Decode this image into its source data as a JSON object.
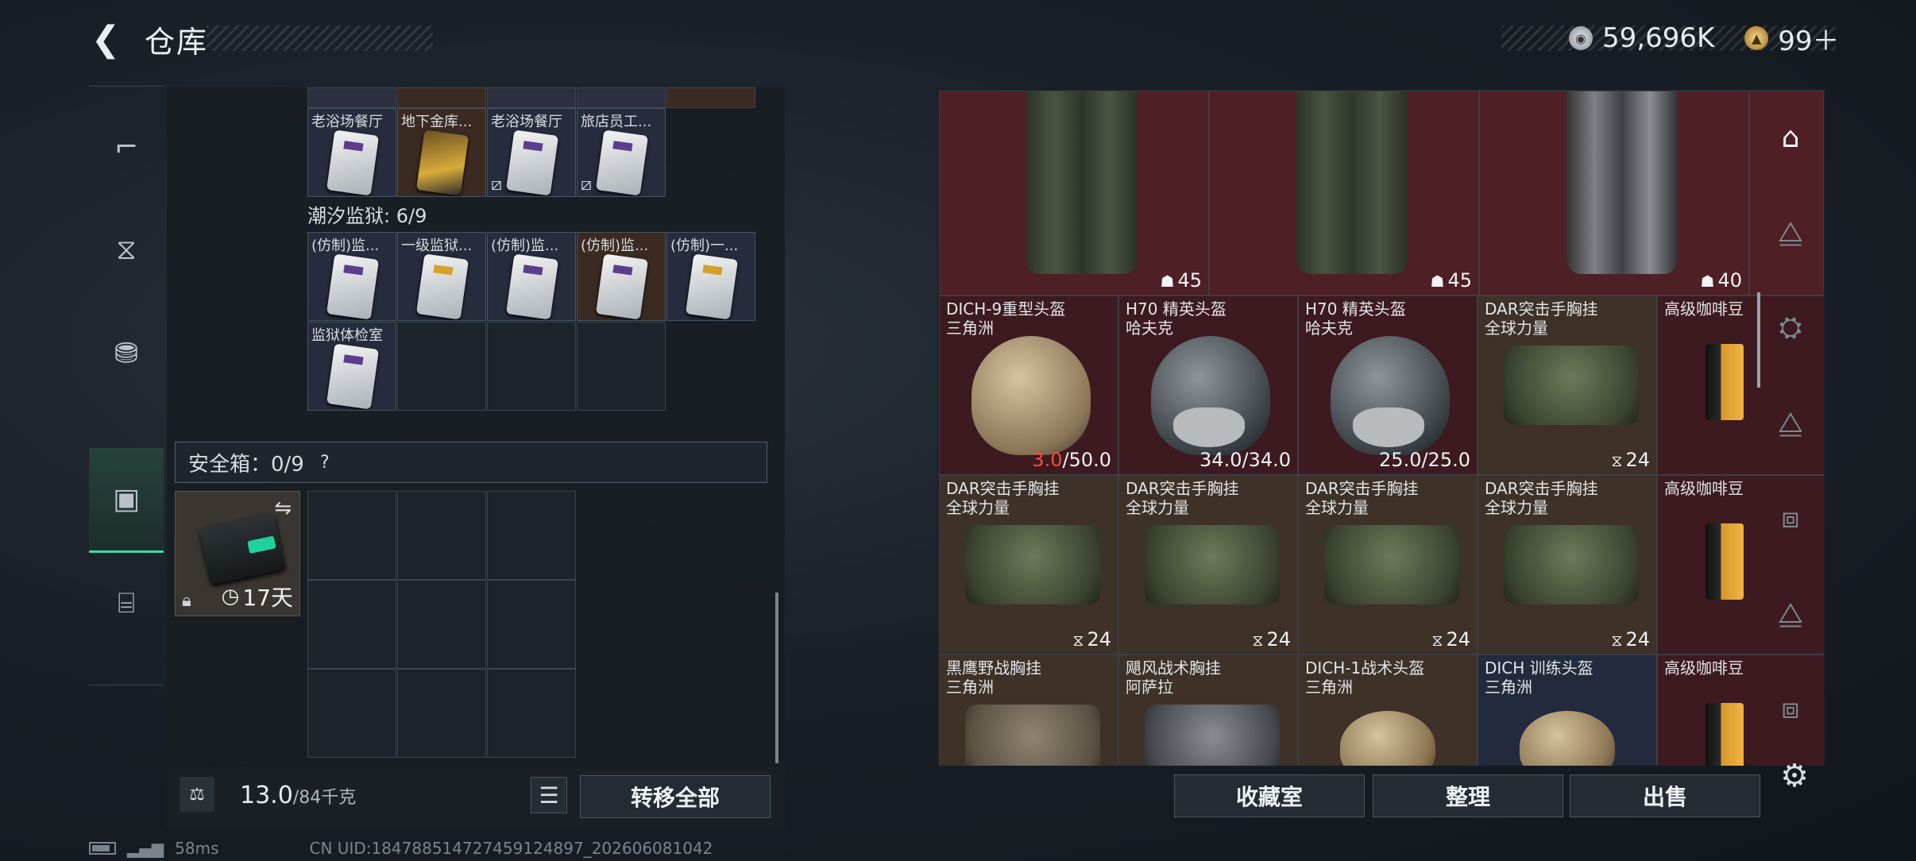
{
  "header": {
    "title": "仓库",
    "back_icon": "back-arrow-icon"
  },
  "currency": {
    "silver": "59,696K",
    "gold": "99＋"
  },
  "left_nav": [
    "gun-icon",
    "vest-icon",
    "backpack-icon",
    "case-icon",
    "toolbox-icon"
  ],
  "keycards_top_row": [
    "老浴场餐厅",
    "地下金库...",
    "老浴场餐厅",
    "旅店员工..."
  ],
  "prison_section": {
    "label": "潮汐监狱: 6/9",
    "cards": [
      "(仿制)监...",
      "一级监狱...",
      "(仿制)监...",
      "(仿制)监...",
      "(仿制)一...",
      "监狱体检室"
    ]
  },
  "safebox": {
    "label": "安全箱：0/9",
    "help": "?",
    "case_timer": "17天"
  },
  "weight": {
    "value": "13.0",
    "max": "/84千克"
  },
  "buttons": {
    "transfer_all": "转移全部",
    "collection": "收藏室",
    "organize": "整理",
    "sell": "出售"
  },
  "stash": {
    "row1": [
      "45",
      "45",
      "40"
    ],
    "row2": [
      {
        "name": "DICH-9重型头盔",
        "sub": "三角洲",
        "val_warn": "3.0",
        "val": "/50.0"
      },
      {
        "name": "H70 精英头盔",
        "sub": "哈夫克",
        "val": "34.0/34.0"
      },
      {
        "name": "H70 精英头盔",
        "sub": "哈夫克",
        "val": "25.0/25.0"
      },
      {
        "name": "DAR突击手胸挂",
        "sub": "全球力量",
        "val": "24"
      },
      {
        "name": "高级咖啡豆",
        "sub": "",
        "val": ""
      }
    ],
    "row3": [
      {
        "name": "DAR突击手胸挂",
        "sub": "全球力量",
        "val": "24"
      },
      {
        "name": "DAR突击手胸挂",
        "sub": "全球力量",
        "val": "24"
      },
      {
        "name": "DAR突击手胸挂",
        "sub": "全球力量",
        "val": "24"
      },
      {
        "name": "DAR突击手胸挂",
        "sub": "全球力量",
        "val": "24"
      },
      {
        "name": "高级咖啡豆",
        "sub": "",
        "val": ""
      }
    ],
    "row4": [
      {
        "name": "黑鹰野战胸挂",
        "sub": "三角洲"
      },
      {
        "name": "飓风战术胸挂",
        "sub": "阿萨拉"
      },
      {
        "name": "DICH-1战术头盔",
        "sub": "三角洲"
      },
      {
        "name": "DICH 训练头盔",
        "sub": "三角洲"
      },
      {
        "name": "高级咖啡豆",
        "sub": ""
      }
    ]
  },
  "status": {
    "ping": "58ms",
    "uid": "CN UID:184788514727459124897_202606081042"
  }
}
